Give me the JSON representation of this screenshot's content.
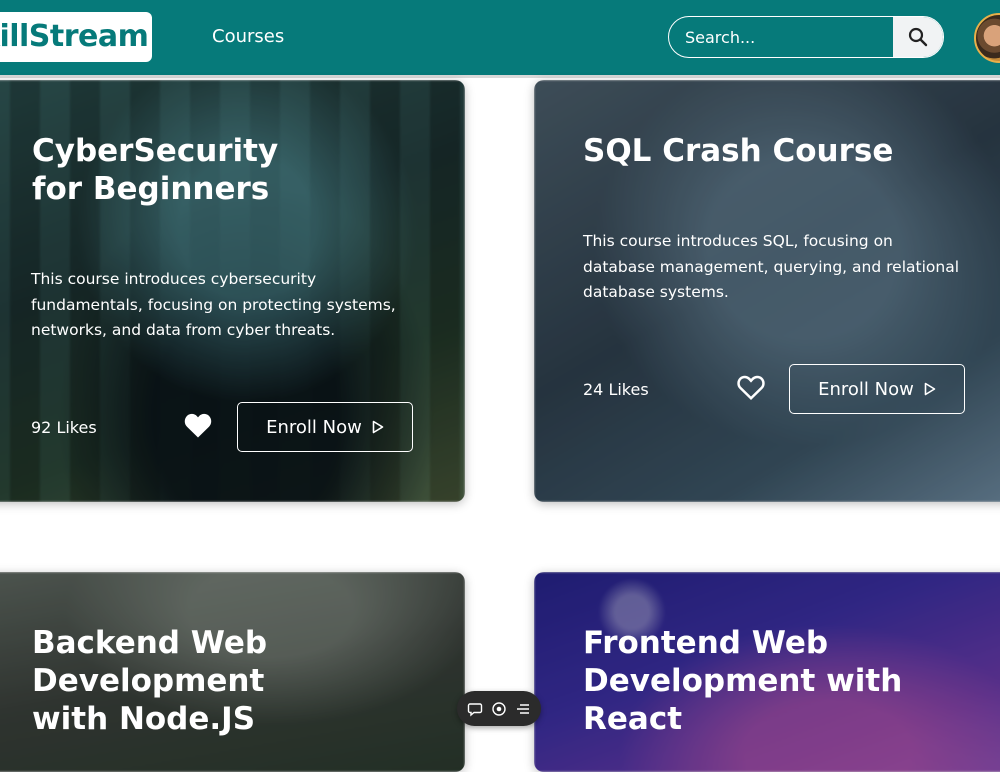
{
  "header": {
    "logo_text": "killStream",
    "nav": {
      "courses_label": "Courses"
    },
    "search": {
      "placeholder": "Search..."
    }
  },
  "courses": [
    {
      "title": "CyberSecurity for Beginners",
      "description": "This course introduces cybersecurity fundamentals, focusing on protecting systems, networks, and data from cyber threats.",
      "likes": "92 Likes",
      "liked": true,
      "enroll_label": "Enroll Now"
    },
    {
      "title": "SQL Crash Course",
      "description": "This course introduces SQL, focusing on database management, querying, and relational database systems.",
      "likes": "24 Likes",
      "liked": false,
      "enroll_label": "Enroll Now"
    },
    {
      "title": "Backend Web Development with Node.JS"
    },
    {
      "title": "Frontend Web Development with React"
    }
  ],
  "colors": {
    "header_bg": "#067a7a",
    "text_on_card": "#ffffff"
  }
}
